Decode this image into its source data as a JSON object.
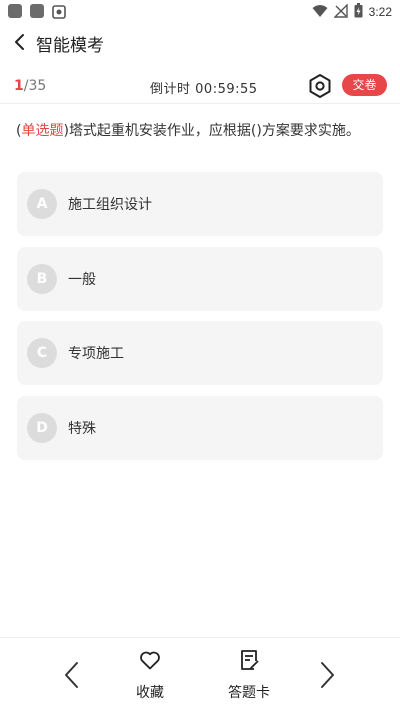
{
  "status_bar": {
    "time": "3:22",
    "icons": [
      "notification-icon",
      "notification-icon",
      "photo-icon",
      "wifi-icon",
      "signal-off-icon",
      "battery-icon"
    ]
  },
  "header": {
    "title": "智能模考"
  },
  "exam": {
    "current": "1",
    "separator": "/",
    "total": "35",
    "countdown_label": "倒计时",
    "countdown_value": "00:59:55",
    "submit_label": "交卷"
  },
  "question": {
    "open_paren": "(",
    "type": "单选题",
    "close_paren": ")",
    "text": "塔式起重机安装作业，应根据()方案要求实施。"
  },
  "options": [
    {
      "letter": "A",
      "text": "施工组织设计"
    },
    {
      "letter": "B",
      "text": "一般"
    },
    {
      "letter": "C",
      "text": "专项施工"
    },
    {
      "letter": "D",
      "text": "特殊"
    }
  ],
  "bottom_bar": {
    "favorite_label": "收藏",
    "answer_card_label": "答题卡"
  },
  "colors": {
    "accent": "#e8474a",
    "option_bg": "#f5f5f5",
    "option_letter_bg": "#dcdcdc"
  }
}
